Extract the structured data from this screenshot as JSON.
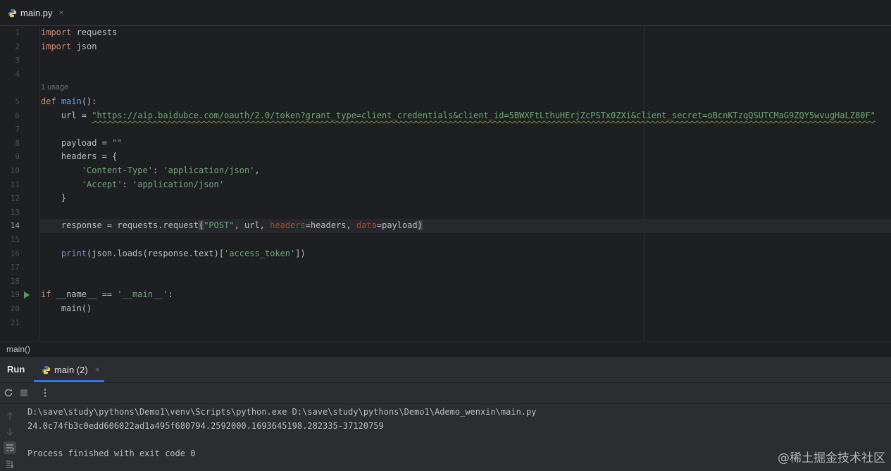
{
  "editor_tab": {
    "filename": "main.py",
    "close": "×",
    "icon": "python-icon"
  },
  "editor": {
    "line_numbers": [
      "1",
      "2",
      "3",
      "4",
      "5",
      "6",
      "7",
      "8",
      "9",
      "10",
      "11",
      "12",
      "13",
      "14",
      "15",
      "16",
      "17",
      "18",
      "19",
      "20",
      "21"
    ],
    "active_line": "14",
    "inlay_hint": "1 usage",
    "code": {
      "l1_kw": "import",
      "l1_rest": " requests",
      "l2_kw": "import",
      "l2_rest": " json",
      "l5_kw": "def",
      "l5_fn": "main",
      "l5_rest": "():",
      "l6_pre": "    url = ",
      "l6_str": "\"https://aip.baidubce.com/oauth/2.0/token?grant_type=client_credentials&client_id=5BWXFtLthuHErjZcPSTx0ZXi&client_secret=oBcnKTzqQSUTCMaG9ZQY5wvugHaLZ80F\"",
      "l8_pre": "    payload = ",
      "l8_str": "\"\"",
      "l9": "    headers = {",
      "l10_pre": "        ",
      "l10_key": "'Content-Type'",
      "l10_mid": ": ",
      "l10_val": "'application/json'",
      "l10_end": ",",
      "l11_pre": "        ",
      "l11_key": "'Accept'",
      "l11_mid": ": ",
      "l11_val": "'application/json'",
      "l12": "    }",
      "l14_pre": "    response = requests.request",
      "l14_open": "(",
      "l14_str": "\"POST\"",
      "l14_a": ", url, ",
      "l14_p1": "headers",
      "l14_b": "=headers, ",
      "l14_p2": "data",
      "l14_c": "=payload",
      "l14_close": ")",
      "l16_pre": "    ",
      "l16_builtin": "print",
      "l16_a": "(json.loads(response.text)[",
      "l16_str": "'access_token'",
      "l16_b": "])",
      "l19_kw": "if",
      "l19_a": " __name__ == ",
      "l19_str": "'__main__'",
      "l19_b": ":",
      "l20": "    main()"
    }
  },
  "breadcrumb": "main()",
  "run_window": {
    "title": "Run",
    "tab_label": "main (2)",
    "tab_close": "×",
    "toolbar_icons": [
      "rerun-icon",
      "stop-icon",
      "more-icon"
    ],
    "console_lines": [
      "D:\\save\\study\\pythons\\Demo1\\venv\\Scripts\\python.exe D:\\save\\study\\pythons\\Demo1\\Ademo_wenxin\\main.py",
      "24.0c74fb3c0edd606022ad1a495f680794.2592000.1693645198.282335-37120759",
      "",
      "Process finished with exit code 0"
    ]
  },
  "watermark": "@稀土掘金技术社区",
  "colors": {
    "background": "#1e1f22",
    "keyword": "#cf8e6d",
    "function": "#56a8f5",
    "string": "#6aab73",
    "accent": "#3574f0"
  }
}
